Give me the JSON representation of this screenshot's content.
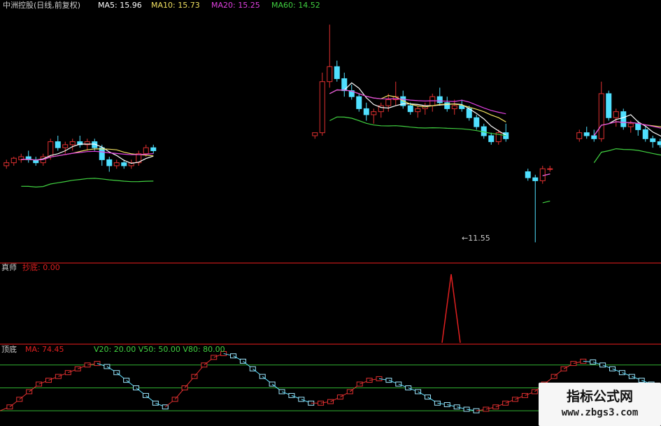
{
  "chart_data": [
    {
      "type": "candlestick",
      "title": "中洲控股(日线,前复权)",
      "ma_labels": [
        {
          "name": "MA5",
          "text": "MA5: 15.96",
          "color": "#ffffff"
        },
        {
          "name": "MA10",
          "text": "MA10: 15.73",
          "color": "#f0e060"
        },
        {
          "name": "MA20",
          "text": "MA20: 15.25",
          "color": "#e040e0"
        },
        {
          "name": "MA60",
          "text": "MA60: 14.52",
          "color": "#40d040"
        }
      ],
      "low_annotation": "11.55",
      "ylim": [
        11.0,
        19.2
      ],
      "candles": [
        [
          14.1,
          14.3,
          14.0,
          14.2
        ],
        [
          14.2,
          14.4,
          14.1,
          14.35
        ],
        [
          14.3,
          14.5,
          14.2,
          14.4
        ],
        [
          14.4,
          14.6,
          14.2,
          14.3
        ],
        [
          14.3,
          14.4,
          14.1,
          14.2
        ],
        [
          14.2,
          14.5,
          14.1,
          14.4
        ],
        [
          14.4,
          15.0,
          14.3,
          14.9
        ],
        [
          14.9,
          15.1,
          14.6,
          14.7
        ],
        [
          14.7,
          14.9,
          14.5,
          14.8
        ],
        [
          14.8,
          15.0,
          14.6,
          14.9
        ],
        [
          14.9,
          15.1,
          14.7,
          14.8
        ],
        [
          14.8,
          15.0,
          14.6,
          14.9
        ],
        [
          14.9,
          15.0,
          14.6,
          14.7
        ],
        [
          14.7,
          14.8,
          14.1,
          14.3
        ],
        [
          14.3,
          14.4,
          13.9,
          14.1
        ],
        [
          14.1,
          14.3,
          14.0,
          14.2
        ],
        [
          14.2,
          14.3,
          14.0,
          14.1
        ],
        [
          14.1,
          14.3,
          14.0,
          14.2
        ],
        [
          14.2,
          14.6,
          14.1,
          14.5
        ],
        [
          14.5,
          14.8,
          14.4,
          14.7
        ],
        [
          14.7,
          14.8,
          14.5,
          14.6
        ],
        null,
        null,
        null,
        null,
        null,
        null,
        null,
        null,
        null,
        null,
        null,
        null,
        null,
        null,
        null,
        null,
        null,
        null,
        null,
        null,
        null,
        [
          15.1,
          15.2,
          15.0,
          15.2
        ],
        [
          15.2,
          17.2,
          15.1,
          16.9
        ],
        [
          16.9,
          18.8,
          16.7,
          17.4
        ],
        [
          17.4,
          17.6,
          16.9,
          17.0
        ],
        [
          17.0,
          17.2,
          16.4,
          16.6
        ],
        [
          16.6,
          16.8,
          16.3,
          16.4
        ],
        [
          16.4,
          16.5,
          15.9,
          16.0
        ],
        [
          16.0,
          16.2,
          15.6,
          15.8
        ],
        [
          15.8,
          16.0,
          15.5,
          15.9
        ],
        [
          15.9,
          16.2,
          15.7,
          16.1
        ],
        [
          16.1,
          16.5,
          15.9,
          16.3
        ],
        [
          16.3,
          16.9,
          16.1,
          16.4
        ],
        [
          16.4,
          16.6,
          16.0,
          16.1
        ],
        [
          16.1,
          16.2,
          15.8,
          15.9
        ],
        [
          15.9,
          16.1,
          15.7,
          16.0
        ],
        [
          16.0,
          16.2,
          15.8,
          16.1
        ],
        [
          16.1,
          16.5,
          15.9,
          16.4
        ],
        [
          16.4,
          16.7,
          16.1,
          16.2
        ],
        [
          16.2,
          16.4,
          15.9,
          16.0
        ],
        [
          16.0,
          16.3,
          15.8,
          16.1
        ],
        [
          16.1,
          16.3,
          15.9,
          16.0
        ],
        [
          16.0,
          16.1,
          15.6,
          15.7
        ],
        [
          15.7,
          15.8,
          15.3,
          15.4
        ],
        [
          15.4,
          15.5,
          15.0,
          15.1
        ],
        [
          15.1,
          15.2,
          14.8,
          14.9
        ],
        [
          14.9,
          15.3,
          14.8,
          15.2
        ],
        [
          15.2,
          15.5,
          14.9,
          15.0
        ],
        null,
        null,
        [
          13.9,
          14.0,
          13.6,
          13.7
        ],
        [
          13.7,
          13.8,
          11.55,
          13.6
        ],
        [
          13.6,
          14.1,
          13.5,
          14.0
        ],
        [
          14.0,
          14.1,
          13.9,
          14.0
        ],
        null,
        null,
        null,
        [
          15.0,
          15.3,
          14.9,
          15.2
        ],
        [
          15.2,
          15.4,
          15.0,
          15.1
        ],
        [
          15.1,
          15.3,
          14.9,
          15.0
        ],
        [
          15.0,
          16.9,
          14.9,
          16.5
        ],
        [
          16.5,
          16.6,
          15.6,
          15.7
        ],
        [
          15.7,
          16.0,
          15.4,
          15.9
        ],
        [
          15.9,
          16.0,
          15.3,
          15.4
        ],
        [
          15.4,
          15.6,
          15.2,
          15.5
        ],
        [
          15.5,
          15.6,
          15.1,
          15.3
        ],
        [
          15.3,
          15.4,
          14.9,
          15.0
        ],
        [
          15.0,
          15.1,
          14.7,
          14.9
        ],
        [
          14.9,
          15.0,
          14.7,
          14.8
        ],
        [
          14.8,
          15.0,
          14.7,
          14.9
        ],
        null,
        [
          15.5,
          16.5,
          15.3,
          16.2
        ],
        [
          16.2,
          16.4,
          15.9,
          16.1
        ],
        [
          16.1,
          16.3,
          15.8,
          15.9
        ],
        [
          15.9,
          16.3,
          15.7,
          16.2
        ],
        [
          16.2,
          16.6,
          16.0,
          16.3
        ],
        [
          16.3,
          17.0,
          16.1,
          16.9
        ],
        [
          16.9,
          17.1,
          16.3,
          16.4
        ],
        [
          16.4,
          16.8,
          16.2,
          16.6
        ]
      ]
    },
    {
      "type": "line",
      "title": "真师",
      "series_label": "抄底: 0.00",
      "color": "#e02020",
      "ylim": [
        0,
        1
      ],
      "x": [
        140,
        141,
        142
      ],
      "values": [
        0,
        1,
        0
      ]
    },
    {
      "type": "line",
      "title": "顶底",
      "ma_label": "MA: 74.45",
      "levels_label": "V20: 20.00  V50: 50.00  V80: 80.00",
      "levels": [
        20,
        50,
        80
      ],
      "ylim": [
        0,
        100
      ],
      "values": [
        20,
        25,
        35,
        45,
        55,
        60,
        65,
        70,
        75,
        80,
        82,
        78,
        70,
        60,
        50,
        40,
        30,
        25,
        35,
        50,
        65,
        80,
        90,
        95,
        92,
        85,
        75,
        65,
        55,
        45,
        40,
        35,
        30,
        30,
        32,
        38,
        45,
        55,
        60,
        62,
        60,
        55,
        50,
        45,
        38,
        30,
        28,
        25,
        22,
        20,
        22,
        25,
        30,
        35,
        40,
        45,
        55,
        65,
        75,
        82,
        85,
        84,
        80,
        75,
        70,
        65,
        60,
        55
      ]
    }
  ]
}
